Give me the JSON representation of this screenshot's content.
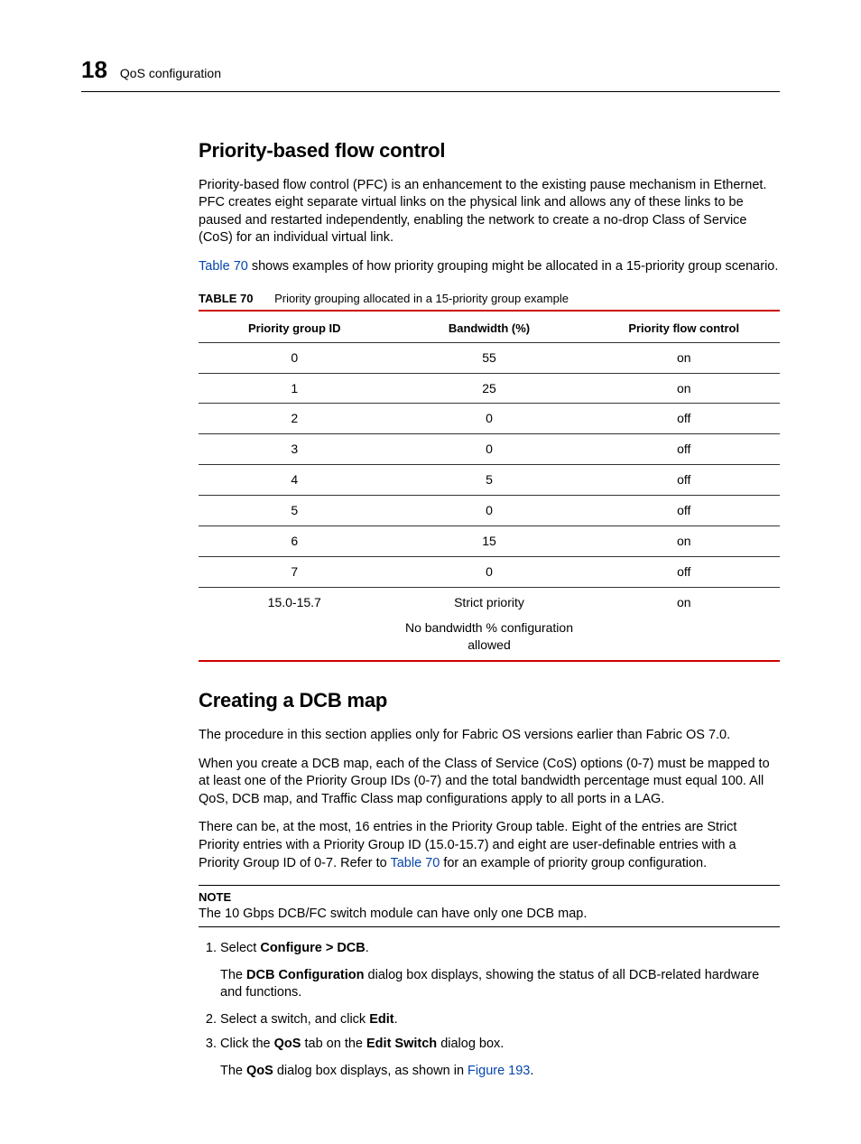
{
  "header": {
    "chapter_number": "18",
    "chapter_title": "QoS configuration"
  },
  "section1": {
    "title": "Priority-based flow control",
    "p1": "Priority-based flow control (PFC) is an enhancement to the existing pause mechanism in Ethernet. PFC creates eight separate virtual links on the physical link and allows any of these links to be paused and restarted independently, enabling the network to create a no-drop Class of Service (CoS) for an individual virtual link.",
    "p2a": "Table 70",
    "p2b": " shows examples of how priority grouping might be allocated in a 15-priority group scenario."
  },
  "table": {
    "label": "TABLE 70",
    "caption": "Priority grouping allocated in a 15-priority group example",
    "headers": {
      "c1": "Priority group ID",
      "c2": "Bandwidth (%)",
      "c3": "Priority flow control"
    },
    "rows": [
      {
        "c1": "0",
        "c2": "55",
        "c3": "on"
      },
      {
        "c1": "1",
        "c2": "25",
        "c3": "on"
      },
      {
        "c1": "2",
        "c2": "0",
        "c3": "off"
      },
      {
        "c1": "3",
        "c2": "0",
        "c3": "off"
      },
      {
        "c1": "4",
        "c2": "5",
        "c3": "off"
      },
      {
        "c1": "5",
        "c2": "0",
        "c3": "off"
      },
      {
        "c1": "6",
        "c2": "15",
        "c3": "on"
      },
      {
        "c1": "7",
        "c2": "0",
        "c3": "off"
      },
      {
        "c1": "15.0-15.7",
        "c2": "Strict priority",
        "c3": "on"
      }
    ],
    "footer_c2": "No bandwidth % configuration allowed"
  },
  "section2": {
    "title": "Creating a DCB map",
    "p1": "The procedure in this section applies only for Fabric OS versions earlier than Fabric OS 7.0.",
    "p2": "When you create a DCB map, each of the Class of Service (CoS) options (0-7) must be mapped to at least one of the Priority Group IDs (0-7) and the total bandwidth percentage must equal 100. All QoS, DCB map, and Traffic Class map configurations apply to all ports in a LAG.",
    "p3a": "There can be, at the most, 16 entries in the Priority Group table. Eight of the entries are Strict Priority entries with a Priority Group ID (15.0-15.7) and eight are user-definable entries with a Priority Group ID of 0-7. Refer to ",
    "p3link": "Table 70",
    "p3b": " for an example of priority group configuration."
  },
  "note": {
    "label": "NOTE",
    "text": "The 10 Gbps DCB/FC switch module can have only one DCB map."
  },
  "steps": {
    "s1_a": "Select ",
    "s1_b": "Configure > DCB",
    "s1_c": ".",
    "s1_body_a": "The ",
    "s1_body_b": "DCB Configuration",
    "s1_body_c": " dialog box displays, showing the status of all DCB-related hardware and functions.",
    "s2_a": "Select a switch, and click ",
    "s2_b": "Edit",
    "s2_c": ".",
    "s3_a": "Click the ",
    "s3_b": "QoS",
    "s3_c": " tab on the ",
    "s3_d": "Edit Switch",
    "s3_e": " dialog box.",
    "s3_body_a": "The ",
    "s3_body_b": "QoS",
    "s3_body_c": " dialog box displays, as shown in ",
    "s3_body_link": "Figure 193",
    "s3_body_d": "."
  }
}
